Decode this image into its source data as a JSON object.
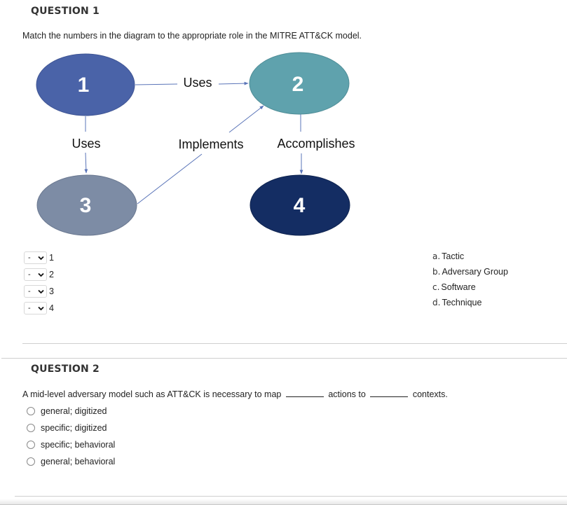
{
  "question1": {
    "title": "QUESTION 1",
    "prompt": "Match the numbers in the diagram to the appropriate role in the MITRE ATT&CK model.",
    "diagram": {
      "nodes": [
        {
          "id": "1",
          "label": "1",
          "color": "#4a63a8"
        },
        {
          "id": "2",
          "label": "2",
          "color": "#5fa2ad"
        },
        {
          "id": "3",
          "label": "3",
          "color": "#7d8ca5"
        },
        {
          "id": "4",
          "label": "4",
          "color": "#142d63"
        }
      ],
      "edges": [
        {
          "from": "1",
          "to": "2",
          "label": "Uses"
        },
        {
          "from": "1",
          "to": "3",
          "label": "Uses"
        },
        {
          "from": "3",
          "to": "2",
          "label": "Implements"
        },
        {
          "from": "2",
          "to": "4",
          "label": "Accomplishes"
        }
      ],
      "edge_color": "#5a74b8"
    },
    "matches": [
      {
        "selected": "-",
        "item": "1"
      },
      {
        "selected": "-",
        "item": "2"
      },
      {
        "selected": "-",
        "item": "3"
      },
      {
        "selected": "-",
        "item": "4"
      }
    ],
    "answers": [
      {
        "letter": "a.",
        "text": "Tactic"
      },
      {
        "letter": "b.",
        "text": "Adversary Group"
      },
      {
        "letter": "c.",
        "text": "Software"
      },
      {
        "letter": "d.",
        "text": "Technique"
      }
    ]
  },
  "question2": {
    "title": "QUESTION 2",
    "prompt_part1": "A mid-level adversary model such as ATT&CK is necessary to map",
    "prompt_part2": "actions to",
    "prompt_part3": "contexts.",
    "options": [
      {
        "label": "general; digitized",
        "selected": false
      },
      {
        "label": "specific; digitized",
        "selected": false
      },
      {
        "label": "specific; behavioral",
        "selected": false
      },
      {
        "label": "general; behavioral",
        "selected": false
      }
    ]
  }
}
